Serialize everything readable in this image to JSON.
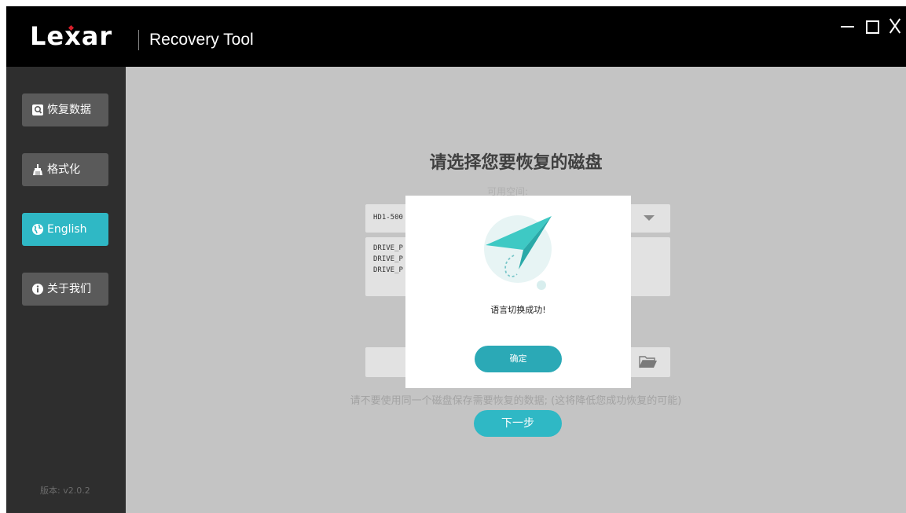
{
  "titlebar": {
    "logo": "Lexar",
    "logo_parts": [
      "Le",
      "x",
      "ar"
    ],
    "app_title": "Recovery Tool",
    "controls": [
      "minimize-icon",
      "maximize-icon",
      "close-icon"
    ]
  },
  "sidebar": {
    "items": [
      {
        "label": "恢复数据",
        "icon": "recover-icon",
        "active": false
      },
      {
        "label": "格式化",
        "icon": "broom-icon",
        "active": false
      },
      {
        "label": "English",
        "icon": "globe-icon",
        "active": true
      },
      {
        "label": "关于我们",
        "icon": "info-icon",
        "active": false
      }
    ],
    "version": "版本: v2.0.2"
  },
  "main": {
    "title": "请选择您要恢复的磁盘",
    "space_label": "可用空间:",
    "disk_select_value": "HD1-500",
    "partitions": [
      "DRIVE_P",
      "DRIVE_P",
      "DRIVE_P"
    ],
    "hint": "请不要使用同一个磁盘保存需要恢复的数据; (这将降低您成功恢复的可能)",
    "next_button": "下一步"
  },
  "modal": {
    "message": "语言切换成功!",
    "ok_button": "确定"
  },
  "colors": {
    "accent": "#2fb8c5",
    "sidebar_bg": "#2e2e2e",
    "overlay_bg": "#c4c4c4",
    "logo_dot": "#d81e2a"
  }
}
